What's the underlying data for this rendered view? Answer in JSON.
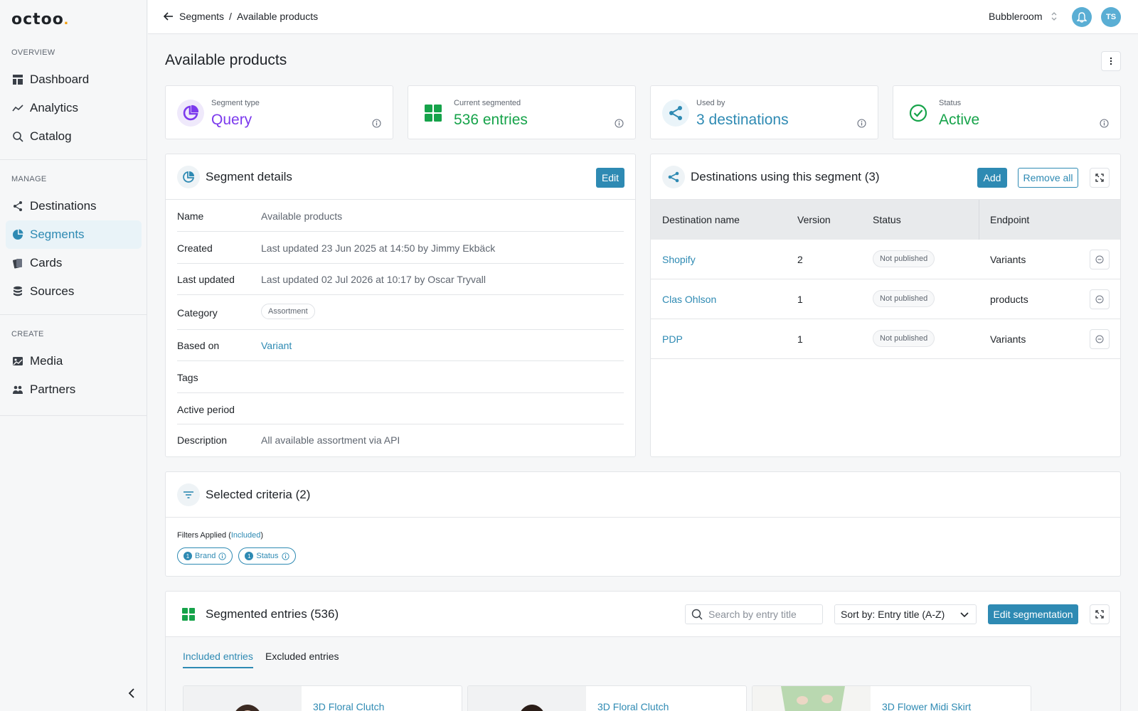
{
  "brand": {
    "logo_text": "octoo",
    "accent": "#2e8ab3",
    "success": "#16a34a",
    "query": "#7c3aed"
  },
  "sidebar": {
    "sections": [
      {
        "title": "OVERVIEW",
        "items": [
          {
            "label": "Dashboard",
            "icon": "dashboard-icon"
          },
          {
            "label": "Analytics",
            "icon": "analytics-icon"
          },
          {
            "label": "Catalog",
            "icon": "search-icon"
          }
        ]
      },
      {
        "title": "MANAGE",
        "items": [
          {
            "label": "Destinations",
            "icon": "share-icon"
          },
          {
            "label": "Segments",
            "icon": "pie-icon",
            "active": true
          },
          {
            "label": "Cards",
            "icon": "cards-icon"
          },
          {
            "label": "Sources",
            "icon": "database-icon"
          }
        ]
      },
      {
        "title": "CREATE",
        "items": [
          {
            "label": "Media",
            "icon": "image-icon"
          },
          {
            "label": "Partners",
            "icon": "people-icon"
          }
        ]
      }
    ]
  },
  "topbar": {
    "breadcrumb": [
      "Segments",
      "Available products"
    ],
    "separator": "/",
    "organization": "Bubbleroom",
    "avatar_initials": "TS"
  },
  "page": {
    "title": "Available products"
  },
  "stats": [
    {
      "label": "Segment type",
      "value": "Query",
      "color": "#7c3aed",
      "icon": "pie-icon"
    },
    {
      "label": "Current segmented",
      "value": "536 entries",
      "color": "#16a34a",
      "icon": "grid-icon"
    },
    {
      "label": "Used by",
      "value": "3 destinations",
      "color": "#2e8ab3",
      "icon": "share-icon"
    },
    {
      "label": "Status",
      "value": "Active",
      "color": "#16a34a",
      "icon": "check-circle-icon"
    }
  ],
  "details": {
    "title": "Segment details",
    "edit_label": "Edit",
    "rows": [
      {
        "key": "Name",
        "value": "Available products"
      },
      {
        "key": "Created",
        "value": "Last updated 23 Jun 2025 at 14:50 by Jimmy Ekbäck"
      },
      {
        "key": "Last updated",
        "value": "Last updated 02 Jul 2026 at 10:17 by Oscar Tryvall"
      },
      {
        "key": "Category",
        "value": "Assortment"
      },
      {
        "key": "Based on",
        "value": "Variant"
      },
      {
        "key": "Tags",
        "value": ""
      },
      {
        "key": "Active period",
        "value": ""
      },
      {
        "key": "Description",
        "value": "All available assortment via API"
      }
    ]
  },
  "destinations": {
    "title": "Destinations using this segment (3)",
    "add_label": "Add",
    "remove_all_label": "Remove all",
    "columns": [
      "Destination name",
      "Version",
      "Status",
      "Endpoint"
    ],
    "rows": [
      {
        "name": "Shopify",
        "version": "2",
        "status": "Not published",
        "endpoint": "Variants"
      },
      {
        "name": "Clas Ohlson",
        "version": "1",
        "status": "Not published",
        "endpoint": "products"
      },
      {
        "name": "PDP",
        "version": "1",
        "status": "Not published",
        "endpoint": "Variants"
      }
    ]
  },
  "criteria": {
    "title": "Selected criteria (2)",
    "filters_prefix": "Filters Applied (",
    "filters_mode": "Included",
    "filters_suffix": ")",
    "chips": [
      {
        "count": "1",
        "label": "Brand"
      },
      {
        "count": "1",
        "label": "Status"
      }
    ]
  },
  "entries": {
    "title": "Segmented entries (536)",
    "search_placeholder": "Search by entry title",
    "sort_label": "Sort by: Entry title (A-Z)",
    "edit_label": "Edit segmentation",
    "tabs": [
      "Included entries",
      "Excluded entries"
    ],
    "cards": [
      {
        "title": "3D Floral Clutch"
      },
      {
        "title": "3D Floral Clutch"
      },
      {
        "title": "3D Flower Midi Skirt"
      }
    ]
  }
}
